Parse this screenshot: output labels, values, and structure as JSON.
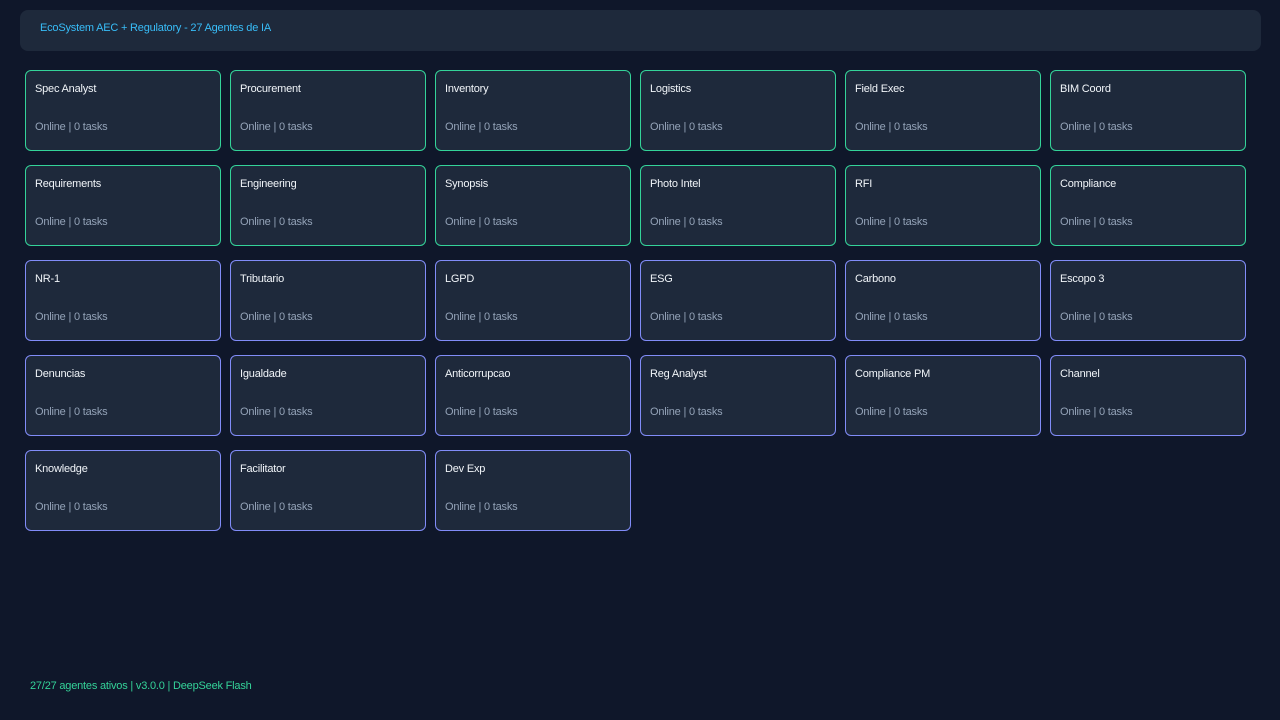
{
  "header": {
    "title": "EcoSystem AEC + Regulatory - 27 Agentes de IA"
  },
  "colors": {
    "background": "#0f172a",
    "card_bg": "#1e293b",
    "accent_title": "#38bdf8",
    "border_aec": "#34d399",
    "border_regulatory": "#818cf8",
    "status_text": "#94a3b8",
    "footer_text": "#34d399"
  },
  "agents": [
    {
      "name": "Spec Analyst",
      "status": "Online | 0 tasks",
      "group": "aec"
    },
    {
      "name": "Procurement",
      "status": "Online | 0 tasks",
      "group": "aec"
    },
    {
      "name": "Inventory",
      "status": "Online | 0 tasks",
      "group": "aec"
    },
    {
      "name": "Logistics",
      "status": "Online | 0 tasks",
      "group": "aec"
    },
    {
      "name": "Field Exec",
      "status": "Online | 0 tasks",
      "group": "aec"
    },
    {
      "name": "BIM Coord",
      "status": "Online | 0 tasks",
      "group": "aec"
    },
    {
      "name": "Requirements",
      "status": "Online | 0 tasks",
      "group": "aec"
    },
    {
      "name": "Engineering",
      "status": "Online | 0 tasks",
      "group": "aec"
    },
    {
      "name": "Synopsis",
      "status": "Online | 0 tasks",
      "group": "aec"
    },
    {
      "name": "Photo Intel",
      "status": "Online | 0 tasks",
      "group": "aec"
    },
    {
      "name": "RFI",
      "status": "Online | 0 tasks",
      "group": "aec"
    },
    {
      "name": "Compliance",
      "status": "Online | 0 tasks",
      "group": "aec"
    },
    {
      "name": "NR-1",
      "status": "Online | 0 tasks",
      "group": "regulatory"
    },
    {
      "name": "Tributario",
      "status": "Online | 0 tasks",
      "group": "regulatory"
    },
    {
      "name": "LGPD",
      "status": "Online | 0 tasks",
      "group": "regulatory"
    },
    {
      "name": "ESG",
      "status": "Online | 0 tasks",
      "group": "regulatory"
    },
    {
      "name": "Carbono",
      "status": "Online | 0 tasks",
      "group": "regulatory"
    },
    {
      "name": "Escopo 3",
      "status": "Online | 0 tasks",
      "group": "regulatory"
    },
    {
      "name": "Denuncias",
      "status": "Online | 0 tasks",
      "group": "regulatory"
    },
    {
      "name": "Igualdade",
      "status": "Online | 0 tasks",
      "group": "regulatory"
    },
    {
      "name": "Anticorrupcao",
      "status": "Online | 0 tasks",
      "group": "regulatory"
    },
    {
      "name": "Reg Analyst",
      "status": "Online | 0 tasks",
      "group": "regulatory"
    },
    {
      "name": "Compliance PM",
      "status": "Online | 0 tasks",
      "group": "regulatory"
    },
    {
      "name": "Channel",
      "status": "Online | 0 tasks",
      "group": "regulatory"
    },
    {
      "name": "Knowledge",
      "status": "Online | 0 tasks",
      "group": "regulatory"
    },
    {
      "name": "Facilitator",
      "status": "Online | 0 tasks",
      "group": "regulatory"
    },
    {
      "name": "Dev Exp",
      "status": "Online | 0 tasks",
      "group": "regulatory"
    }
  ],
  "footer": {
    "text": "27/27 agentes ativos | v3.0.0 | DeepSeek Flash"
  }
}
